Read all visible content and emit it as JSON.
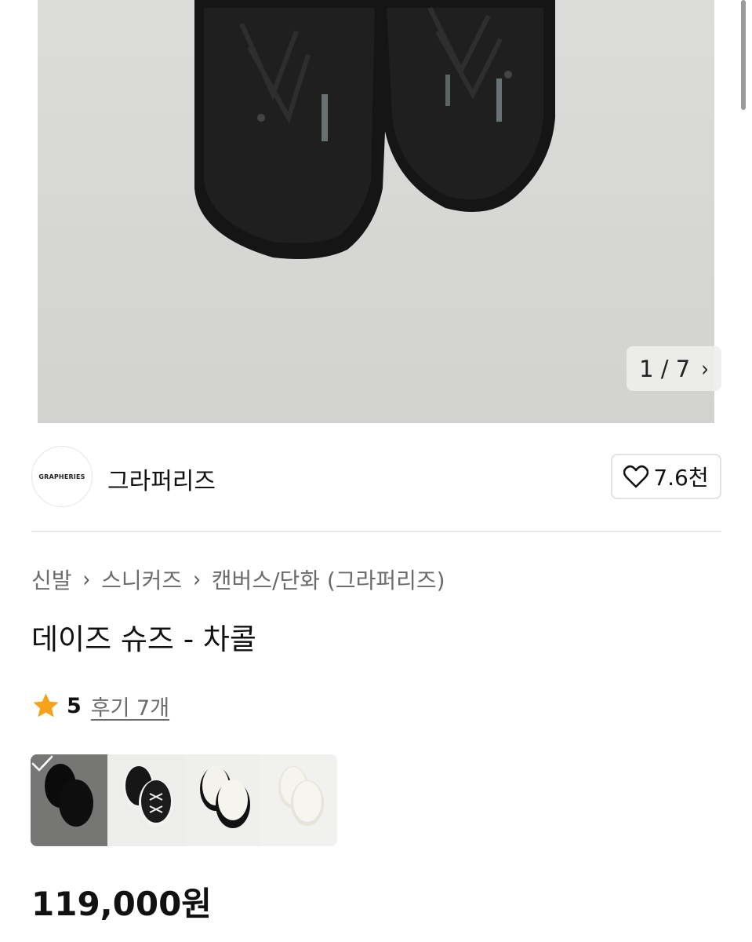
{
  "gallery": {
    "pager_current": "1",
    "pager_separator": "/",
    "pager_total": "7",
    "pager_next_icon": "chevron-right-icon"
  },
  "brand": {
    "logo_text": "GRAPHERIES",
    "name": "그라퍼리즈",
    "like_icon": "heart-outline-icon",
    "like_count": "7.6천"
  },
  "breadcrumb": {
    "items": [
      "신발",
      "스니커즈",
      "캔버스/단화 (그라퍼리즈)"
    ],
    "separator_icon": "chevron-right-icon"
  },
  "product": {
    "title": "데이즈 슈즈 - 차콜",
    "rating_icon": "star-icon",
    "rating": "5",
    "reviews": "후기 7개",
    "price": "119,000원"
  },
  "swatches": {
    "selected_index": 0,
    "check_icon": "checkmark-icon",
    "items": [
      {
        "variant": "charcoal",
        "selected": true
      },
      {
        "variant": "black-white-sole",
        "selected": false
      },
      {
        "variant": "ivory-black-sole",
        "selected": false
      },
      {
        "variant": "ivory",
        "selected": false
      }
    ]
  },
  "colors": {
    "star": "#F5A31A",
    "text_primary": "#111111",
    "text_secondary": "#6B6B6B",
    "border": "#E2E2E2",
    "photo_bg": "#D6D6D4"
  }
}
